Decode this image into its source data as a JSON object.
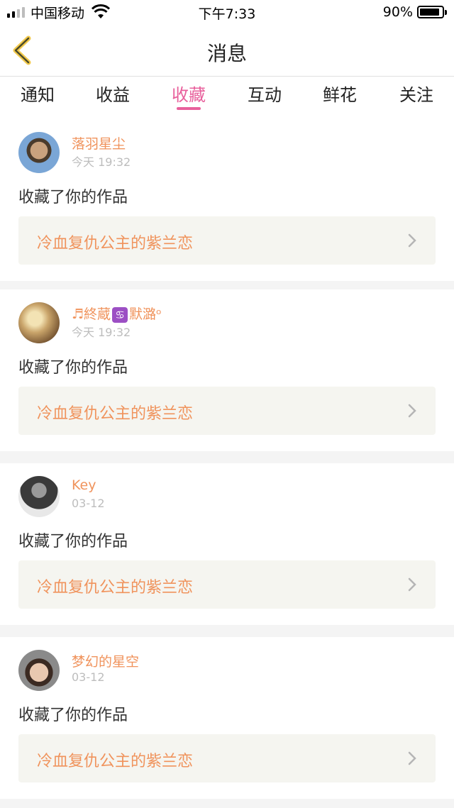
{
  "status": {
    "carrier": "中国移动",
    "time": "下午7:33",
    "battery": "90%",
    "battery_level": 0.9
  },
  "nav": {
    "title": "消息"
  },
  "tabs": [
    {
      "label": "通知"
    },
    {
      "label": "收益"
    },
    {
      "label": "收藏"
    },
    {
      "label": "互动"
    },
    {
      "label": "鲜花"
    },
    {
      "label": "关注"
    }
  ],
  "active_tab": "收藏",
  "accent_color": "#e8609c",
  "link_color": "#f0935c",
  "items": [
    {
      "user": "落羽星尘",
      "time": "今天 19:32",
      "action": "收藏了你的作品",
      "work": "冷血复仇公主的紫兰恋"
    },
    {
      "user_prefix": "♬終蔵",
      "user_emoji": "♋",
      "user_suffix": "默潞ᵒ",
      "time": "今天 19:32",
      "action": "收藏了你的作品",
      "work": "冷血复仇公主的紫兰恋"
    },
    {
      "user": "Key",
      "time": "03-12",
      "action": "收藏了你的作品",
      "work": "冷血复仇公主的紫兰恋"
    },
    {
      "user": "梦幻的星空",
      "time": "03-12",
      "action": "收藏了你的作品",
      "work": "冷血复仇公主的紫兰恋"
    }
  ]
}
